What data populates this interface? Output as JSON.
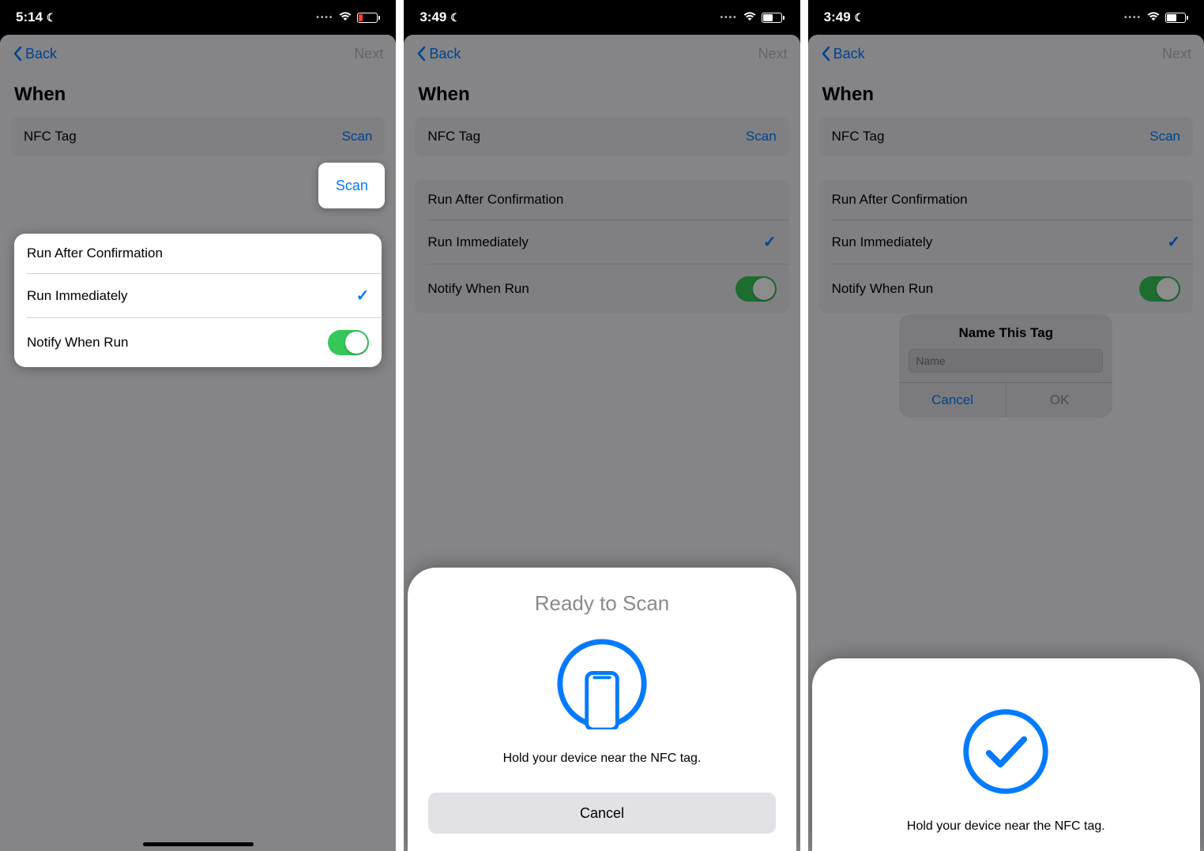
{
  "panels": [
    {
      "statusbar": {
        "time": "5:14",
        "battery_state": "low-red"
      },
      "nav": {
        "back": "Back",
        "next": "Next"
      },
      "when_heading": "When",
      "nfc_row": {
        "label": "NFC Tag",
        "action": "Scan"
      },
      "options": {
        "run_after": "Run After Confirmation",
        "run_immediately": "Run Immediately",
        "notify": "Notify When Run",
        "immediately_checked": true,
        "notify_on": true
      },
      "highlight": "scan_and_options"
    },
    {
      "statusbar": {
        "time": "3:49",
        "battery_state": "half"
      },
      "nav": {
        "back": "Back",
        "next": "Next"
      },
      "when_heading": "When",
      "nfc_row": {
        "label": "NFC Tag",
        "action": "Scan"
      },
      "options": {
        "run_after": "Run After Confirmation",
        "run_immediately": "Run Immediately",
        "notify": "Notify When Run",
        "immediately_checked": true,
        "notify_on": true
      },
      "sheet": {
        "title": "Ready to Scan",
        "hint": "Hold your device near the NFC tag.",
        "cancel": "Cancel",
        "icon": "nfc"
      }
    },
    {
      "statusbar": {
        "time": "3:49",
        "battery_state": "half"
      },
      "nav": {
        "back": "Back",
        "next": "Next"
      },
      "when_heading": "When",
      "nfc_row": {
        "label": "NFC Tag",
        "action": "Scan"
      },
      "options": {
        "run_after": "Run After Confirmation",
        "run_immediately": "Run Immediately",
        "notify": "Notify When Run",
        "immediately_checked": true,
        "notify_on": true
      },
      "alert": {
        "title": "Name This Tag",
        "placeholder": "Name",
        "cancel": "Cancel",
        "ok": "OK"
      },
      "sheet": {
        "hint": "Hold your device near the NFC tag.",
        "icon": "success"
      }
    }
  ]
}
